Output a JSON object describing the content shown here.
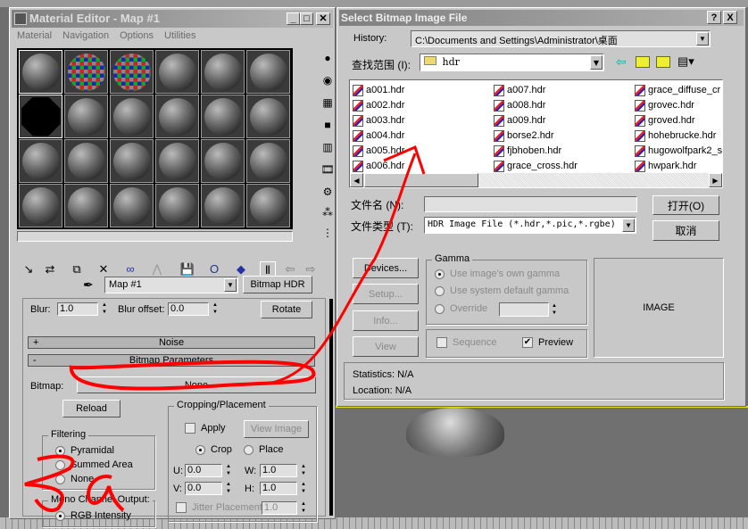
{
  "material_editor": {
    "title": "Material Editor - Map #1",
    "menu": [
      "Material",
      "Navigation",
      "Options",
      "Utilities"
    ],
    "map_name": "Map #1",
    "map_type_button": "Bitmap HDR",
    "blur_label": "Blur:",
    "blur_value": "1.0",
    "blur_offset_label": "Blur offset:",
    "blur_offset_value": "0.0",
    "rotate_button": "Rotate",
    "noise_rollout": "Noise",
    "noise_sign": "+",
    "bitmap_rollout": "Bitmap Parameters",
    "bitmap_sign": "-",
    "bitmap_label": "Bitmap:",
    "bitmap_value": "None",
    "reload_button": "Reload",
    "filtering": {
      "title": "Filtering",
      "options": [
        "Pyramidal",
        "Summed Area",
        "None"
      ],
      "selected": "Pyramidal"
    },
    "mono": {
      "title": "Mono Channel Output:",
      "option": "RGB Intensity"
    },
    "cropping": {
      "title": "Cropping/Placement",
      "apply": "Apply",
      "view_image": "View Image",
      "crop": "Crop",
      "place": "Place",
      "u_label": "U:",
      "u": "0.0",
      "v_label": "V:",
      "v": "0.0",
      "w_label": "W:",
      "w": "1.0",
      "h_label": "H:",
      "h": "1.0",
      "jitter": "Jitter Placement:",
      "jitter_value": "1.0"
    }
  },
  "dialog": {
    "title": "Select Bitmap Image File",
    "help": "?",
    "close": "X",
    "history_label": "History:",
    "history_value": "C:\\Documents and Settings\\Administrator\\桌面",
    "lookin_label": "查找范围 (I):",
    "lookin_value": "hdr",
    "files": [
      [
        "a001.hdr",
        "a002.hdr",
        "a003.hdr",
        "a004.hdr",
        "a005.hdr",
        "a006.hdr"
      ],
      [
        "a007.hdr",
        "a008.hdr",
        "a009.hdr",
        "borse2.hdr",
        "fjbhoben.hdr",
        "grace_cross.hdr"
      ],
      [
        "grace_diffuse_cr",
        "grovec.hdr",
        "groved.hdr",
        "hohebrucke.hdr",
        "hugowolfpark2_s",
        "hwpark.hdr"
      ]
    ],
    "filename_label": "文件名 (N):",
    "filename_value": "",
    "filetype_label": "文件类型 (T):",
    "filetype_value": "HDR Image File (*.hdr,*.pic,*.rgbe)",
    "open_button": "打开(O)",
    "cancel_button": "取消",
    "devices": "Devices...",
    "setup": "Setup...",
    "info": "Info...",
    "view": "View",
    "gamma": {
      "title": "Gamma",
      "own": "Use image's own gamma",
      "system": "Use system default gamma",
      "override": "Override"
    },
    "sequence": "Sequence",
    "preview": "Preview",
    "image_label": "IMAGE",
    "statistics_label": "Statistics:",
    "statistics_value": "N/A",
    "location_label": "Location:",
    "location_value": "N/A"
  }
}
